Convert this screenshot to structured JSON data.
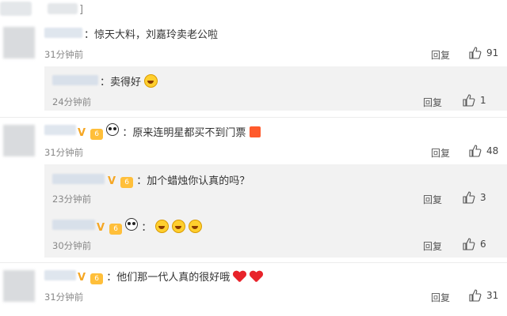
{
  "top": {
    "bracket": "]"
  },
  "comments": [
    {
      "text": "：惊天大料，刘嘉玲卖老公啦",
      "time": "31分钟前",
      "reply_label": "回复",
      "likes": "91"
    },
    {
      "text": "：卖得好",
      "time": "24分钟前",
      "reply_label": "回复",
      "likes": "1"
    },
    {
      "text": "：原来连明星都买不到门票",
      "time": "31分钟前",
      "reply_label": "回复",
      "likes": "48"
    },
    {
      "text": "：加个蜡烛你认真的吗？",
      "time": "23分钟前",
      "reply_label": "回复",
      "likes": "3"
    },
    {
      "text": "：",
      "time": "30分钟前",
      "reply_label": "回复",
      "likes": "6"
    },
    {
      "text": "：他们那一代人真的很好哦",
      "time": "31分钟前",
      "reply_label": "回复",
      "likes": "31"
    }
  ],
  "colors": {
    "badge": "#f5a623",
    "heart": "#e8232a",
    "reply_bg": "#f2f2f2"
  }
}
